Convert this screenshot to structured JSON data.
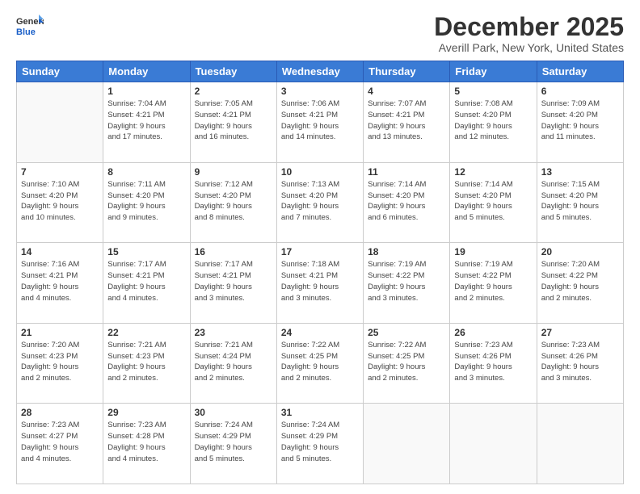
{
  "header": {
    "logo_general": "General",
    "logo_blue": "Blue",
    "month_title": "December 2025",
    "location": "Averill Park, New York, United States"
  },
  "weekdays": [
    "Sunday",
    "Monday",
    "Tuesday",
    "Wednesday",
    "Thursday",
    "Friday",
    "Saturday"
  ],
  "weeks": [
    [
      {
        "day": "",
        "info": ""
      },
      {
        "day": "1",
        "info": "Sunrise: 7:04 AM\nSunset: 4:21 PM\nDaylight: 9 hours\nand 17 minutes."
      },
      {
        "day": "2",
        "info": "Sunrise: 7:05 AM\nSunset: 4:21 PM\nDaylight: 9 hours\nand 16 minutes."
      },
      {
        "day": "3",
        "info": "Sunrise: 7:06 AM\nSunset: 4:21 PM\nDaylight: 9 hours\nand 14 minutes."
      },
      {
        "day": "4",
        "info": "Sunrise: 7:07 AM\nSunset: 4:21 PM\nDaylight: 9 hours\nand 13 minutes."
      },
      {
        "day": "5",
        "info": "Sunrise: 7:08 AM\nSunset: 4:20 PM\nDaylight: 9 hours\nand 12 minutes."
      },
      {
        "day": "6",
        "info": "Sunrise: 7:09 AM\nSunset: 4:20 PM\nDaylight: 9 hours\nand 11 minutes."
      }
    ],
    [
      {
        "day": "7",
        "info": "Sunrise: 7:10 AM\nSunset: 4:20 PM\nDaylight: 9 hours\nand 10 minutes."
      },
      {
        "day": "8",
        "info": "Sunrise: 7:11 AM\nSunset: 4:20 PM\nDaylight: 9 hours\nand 9 minutes."
      },
      {
        "day": "9",
        "info": "Sunrise: 7:12 AM\nSunset: 4:20 PM\nDaylight: 9 hours\nand 8 minutes."
      },
      {
        "day": "10",
        "info": "Sunrise: 7:13 AM\nSunset: 4:20 PM\nDaylight: 9 hours\nand 7 minutes."
      },
      {
        "day": "11",
        "info": "Sunrise: 7:14 AM\nSunset: 4:20 PM\nDaylight: 9 hours\nand 6 minutes."
      },
      {
        "day": "12",
        "info": "Sunrise: 7:14 AM\nSunset: 4:20 PM\nDaylight: 9 hours\nand 5 minutes."
      },
      {
        "day": "13",
        "info": "Sunrise: 7:15 AM\nSunset: 4:20 PM\nDaylight: 9 hours\nand 5 minutes."
      }
    ],
    [
      {
        "day": "14",
        "info": "Sunrise: 7:16 AM\nSunset: 4:21 PM\nDaylight: 9 hours\nand 4 minutes."
      },
      {
        "day": "15",
        "info": "Sunrise: 7:17 AM\nSunset: 4:21 PM\nDaylight: 9 hours\nand 4 minutes."
      },
      {
        "day": "16",
        "info": "Sunrise: 7:17 AM\nSunset: 4:21 PM\nDaylight: 9 hours\nand 3 minutes."
      },
      {
        "day": "17",
        "info": "Sunrise: 7:18 AM\nSunset: 4:21 PM\nDaylight: 9 hours\nand 3 minutes."
      },
      {
        "day": "18",
        "info": "Sunrise: 7:19 AM\nSunset: 4:22 PM\nDaylight: 9 hours\nand 3 minutes."
      },
      {
        "day": "19",
        "info": "Sunrise: 7:19 AM\nSunset: 4:22 PM\nDaylight: 9 hours\nand 2 minutes."
      },
      {
        "day": "20",
        "info": "Sunrise: 7:20 AM\nSunset: 4:22 PM\nDaylight: 9 hours\nand 2 minutes."
      }
    ],
    [
      {
        "day": "21",
        "info": "Sunrise: 7:20 AM\nSunset: 4:23 PM\nDaylight: 9 hours\nand 2 minutes."
      },
      {
        "day": "22",
        "info": "Sunrise: 7:21 AM\nSunset: 4:23 PM\nDaylight: 9 hours\nand 2 minutes."
      },
      {
        "day": "23",
        "info": "Sunrise: 7:21 AM\nSunset: 4:24 PM\nDaylight: 9 hours\nand 2 minutes."
      },
      {
        "day": "24",
        "info": "Sunrise: 7:22 AM\nSunset: 4:25 PM\nDaylight: 9 hours\nand 2 minutes."
      },
      {
        "day": "25",
        "info": "Sunrise: 7:22 AM\nSunset: 4:25 PM\nDaylight: 9 hours\nand 2 minutes."
      },
      {
        "day": "26",
        "info": "Sunrise: 7:23 AM\nSunset: 4:26 PM\nDaylight: 9 hours\nand 3 minutes."
      },
      {
        "day": "27",
        "info": "Sunrise: 7:23 AM\nSunset: 4:26 PM\nDaylight: 9 hours\nand 3 minutes."
      }
    ],
    [
      {
        "day": "28",
        "info": "Sunrise: 7:23 AM\nSunset: 4:27 PM\nDaylight: 9 hours\nand 4 minutes."
      },
      {
        "day": "29",
        "info": "Sunrise: 7:23 AM\nSunset: 4:28 PM\nDaylight: 9 hours\nand 4 minutes."
      },
      {
        "day": "30",
        "info": "Sunrise: 7:24 AM\nSunset: 4:29 PM\nDaylight: 9 hours\nand 5 minutes."
      },
      {
        "day": "31",
        "info": "Sunrise: 7:24 AM\nSunset: 4:29 PM\nDaylight: 9 hours\nand 5 minutes."
      },
      {
        "day": "",
        "info": ""
      },
      {
        "day": "",
        "info": ""
      },
      {
        "day": "",
        "info": ""
      }
    ]
  ]
}
